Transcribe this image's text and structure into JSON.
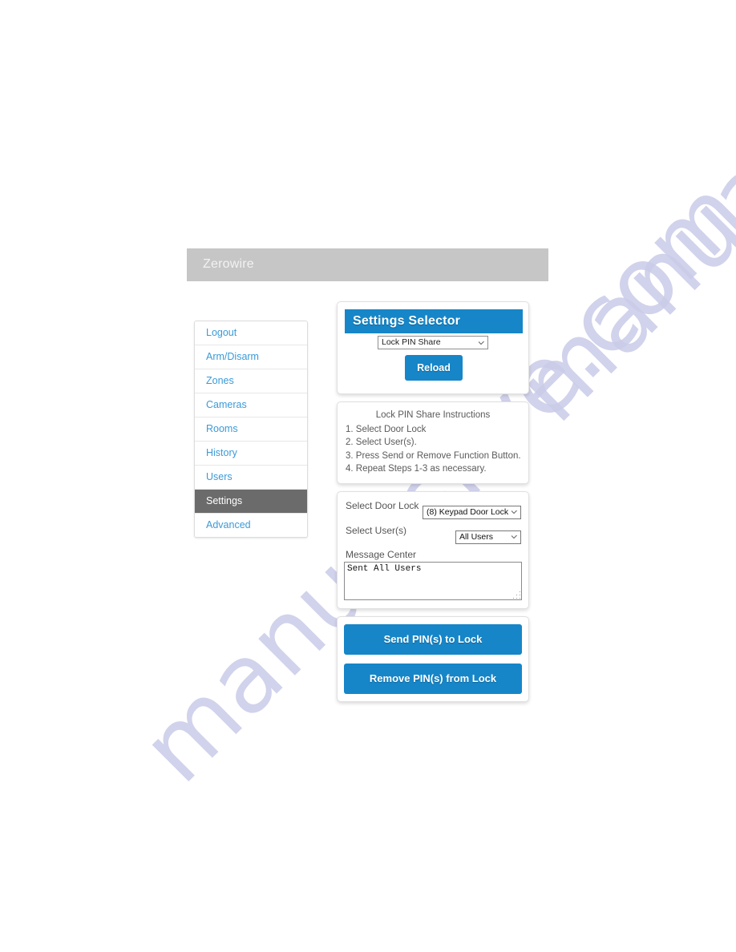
{
  "brand": {
    "title": "Zerowire"
  },
  "sidebar": {
    "items": [
      {
        "label": "Logout",
        "active": false
      },
      {
        "label": "Arm/Disarm",
        "active": false
      },
      {
        "label": "Zones",
        "active": false
      },
      {
        "label": "Cameras",
        "active": false
      },
      {
        "label": "Rooms",
        "active": false
      },
      {
        "label": "History",
        "active": false
      },
      {
        "label": "Users",
        "active": false
      },
      {
        "label": "Settings",
        "active": true
      },
      {
        "label": "Advanced",
        "active": false
      }
    ]
  },
  "selector": {
    "header": "Settings Selector",
    "dropdown_value": "Lock PIN Share",
    "dropdown_options": [
      "Lock PIN Share"
    ],
    "reload_label": "Reload"
  },
  "instructions": {
    "title": "Lock PIN Share Instructions",
    "steps": [
      "1. Select Door Lock",
      "2. Select User(s).",
      "3. Press Send or Remove Function Button.",
      "4. Repeat Steps 1-3 as necessary."
    ]
  },
  "form": {
    "lock_label": "Select Door Lock",
    "lock_value": "(8) Keypad Door Lock",
    "lock_options": [
      "(8) Keypad Door Lock"
    ],
    "users_label": "Select User(s)",
    "users_value": "All Users",
    "users_options": [
      "All Users"
    ],
    "message_label": "Message Center",
    "message_value": "Sent All Users"
  },
  "actions": {
    "send_label": "Send PIN(s) to Lock",
    "remove_label": "Remove PIN(s) from Lock"
  },
  "watermark": {
    "text": "manualslive.com"
  },
  "colors": {
    "accent_blue": "#1686c8",
    "brandbar_gray": "#c6c6c6",
    "active_nav_gray": "#6b6b6b",
    "link_blue": "#3a9ad9",
    "watermark": "#c9cbe8"
  }
}
